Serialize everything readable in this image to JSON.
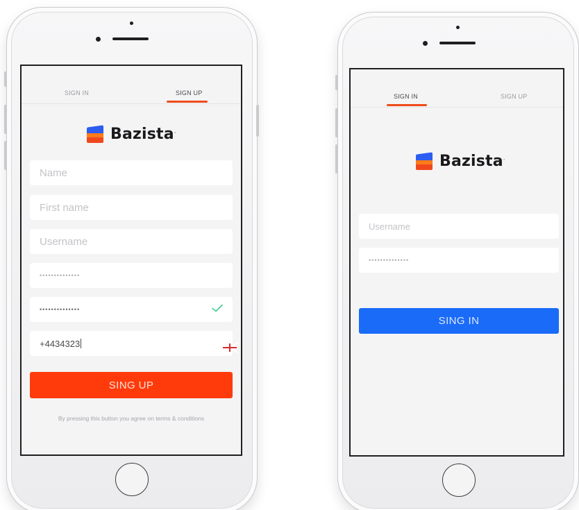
{
  "signup": {
    "tabs": [
      {
        "label": "SIGN IN",
        "active": false
      },
      {
        "label": "SIGN UP",
        "active": true
      }
    ],
    "logo_text": "Bazista",
    "fields": {
      "name_placeholder": "Name",
      "first_name_placeholder": "First name",
      "username_placeholder": "Username",
      "password_mask": "••••••••••••••",
      "confirm_mask": "••••••••••••••",
      "phone_value": "+4434323"
    },
    "confirm_icon": "checkmark-icon",
    "phone_icon": "uk-flag-icon",
    "button_label": "SING UP",
    "terms_text": "By pressing this button you agree on terms & conditions"
  },
  "signin": {
    "tabs": [
      {
        "label": "SIGN IN",
        "active": true
      },
      {
        "label": "SIGN UP",
        "active": false
      }
    ],
    "logo_text": "Bazista",
    "fields": {
      "username_placeholder": "Username",
      "password_mask": "••••••••••••••"
    },
    "button_label": "SING IN"
  },
  "colors": {
    "accent_orange": "#ff3b0c",
    "accent_blue": "#1a6bf7",
    "check_green": "#3ecf8e"
  }
}
